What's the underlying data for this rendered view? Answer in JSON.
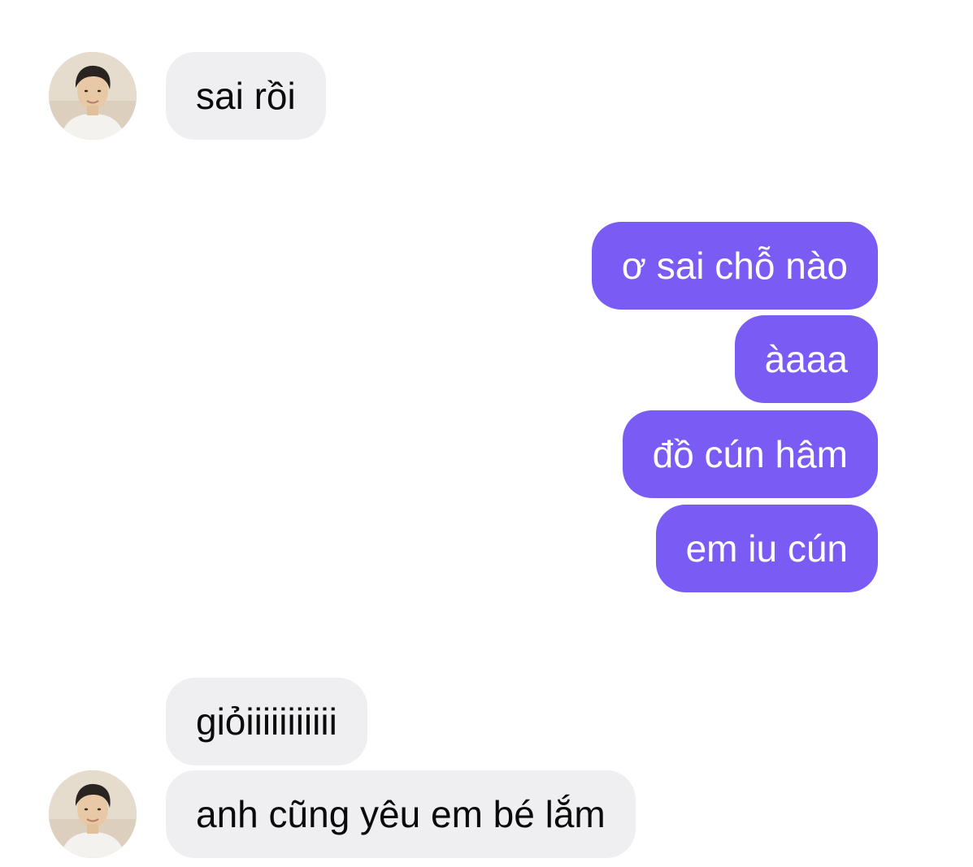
{
  "conversation": {
    "messages": [
      {
        "sender": "contact",
        "text": "sai rồi"
      },
      {
        "sender": "me",
        "text": "ơ sai chỗ nào"
      },
      {
        "sender": "me",
        "text": "àaaa"
      },
      {
        "sender": "me",
        "text": "đồ cún hâm"
      },
      {
        "sender": "me",
        "text": "em iu cún"
      },
      {
        "sender": "contact",
        "text": "giỏiiiiiiiiiii"
      },
      {
        "sender": "contact",
        "text": "anh cũng yêu em bé lắm"
      }
    ]
  },
  "colors": {
    "background": "#ffffff",
    "incoming_bubble": "#efeff2",
    "outgoing_bubble": "#7a5cf5",
    "incoming_text": "#0a0a0a",
    "outgoing_text": "#ffffff"
  },
  "icons": {
    "contact_avatar": "avatar-photo"
  }
}
